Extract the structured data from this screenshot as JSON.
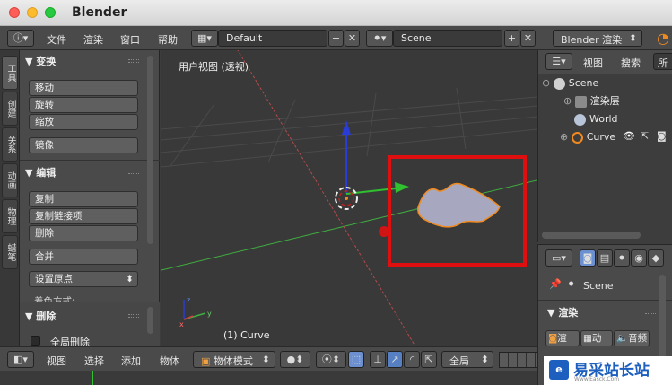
{
  "window": {
    "title": "Blender"
  },
  "info_header": {
    "menus": [
      "文件",
      "渲染",
      "窗口",
      "帮助"
    ],
    "layout": "Default",
    "scene": "Scene",
    "engine": "Blender 渲染"
  },
  "tool_tabs": [
    "工具",
    "创建",
    "关系",
    "动画",
    "物理",
    "蜡笔"
  ],
  "tool_shelf": {
    "transform": {
      "title": "▼ 变换",
      "buttons": [
        "移动",
        "旋转",
        "缩放"
      ],
      "mirror": "镜像"
    },
    "edit": {
      "title": "▼ 编辑",
      "buttons": [
        "复制",
        "复制链接项",
        "删除"
      ],
      "join": "合并",
      "origin": "设置原点 ",
      "shading_partial": "着色方式:"
    },
    "delete_panel": {
      "title": "▼ 删除",
      "checkbox": "全局删除"
    }
  },
  "viewport": {
    "title": "用户视图 (透视)",
    "object_label": "(1) Curve"
  },
  "view3d_header": {
    "menus": [
      "视图",
      "选择",
      "添加",
      "物体"
    ],
    "mode": "物体模式",
    "orientation": "全局"
  },
  "outliner": {
    "menus": [
      "视图",
      "搜索",
      "所"
    ],
    "items": [
      {
        "label": "Scene",
        "icon": "scene-icon"
      },
      {
        "label": "渲染层",
        "icon": "render-layers-icon"
      },
      {
        "label": "World",
        "icon": "world-icon"
      },
      {
        "label": "Curve",
        "icon": "curve-icon"
      }
    ]
  },
  "properties": {
    "scene": "Scene",
    "panel_title": "▼ 渲染",
    "buttons": [
      "渲",
      "动",
      "音频"
    ]
  },
  "watermark": {
    "text": "易采站长站",
    "sub": "Www.Easck.Com"
  },
  "colors": {
    "highlight": "#e00f0f",
    "axis_x": "#c84040",
    "axis_y": "#30a830",
    "axis_z": "#2a3cd8",
    "curve_fill": "#a7a8c0",
    "curve_edge": "#f08a20"
  }
}
